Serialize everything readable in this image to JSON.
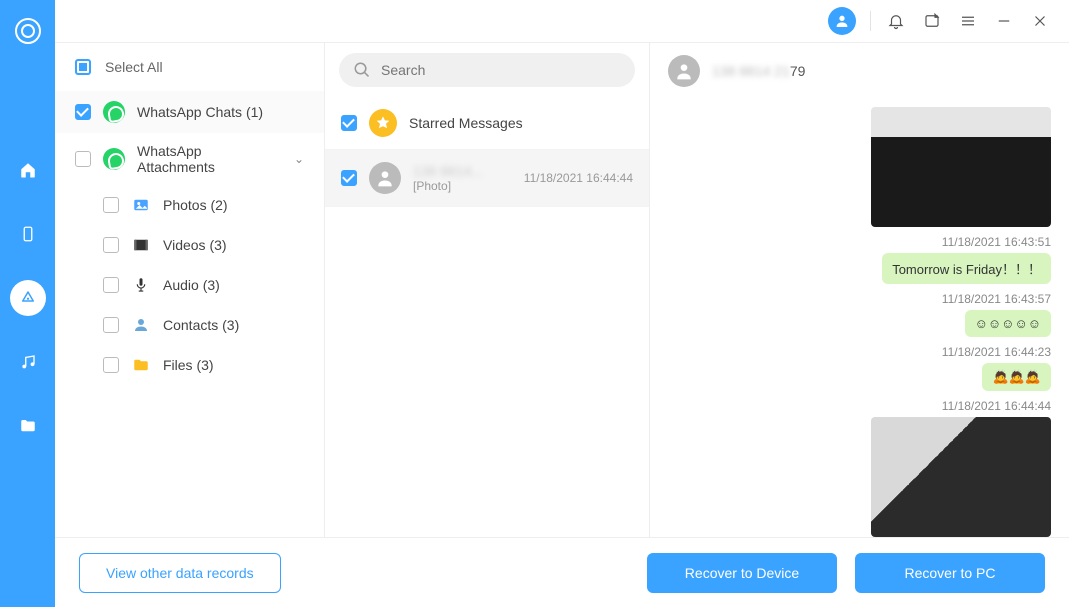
{
  "tree": {
    "select_all": "Select All",
    "items": [
      {
        "label": "WhatsApp Chats (1)",
        "icon": "whatsapp",
        "checked": true,
        "active": true,
        "level": 1
      },
      {
        "label": "WhatsApp Attachments",
        "icon": "whatsapp",
        "checked": false,
        "level": 1,
        "expandable": true
      },
      {
        "label": "Photos (2)",
        "icon": "photo",
        "checked": false,
        "level": 2
      },
      {
        "label": "Videos (3)",
        "icon": "video",
        "checked": false,
        "level": 2
      },
      {
        "label": "Audio (3)",
        "icon": "audio",
        "checked": false,
        "level": 2
      },
      {
        "label": "Contacts (3)",
        "icon": "contact",
        "checked": false,
        "level": 2
      },
      {
        "label": "Files (3)",
        "icon": "file",
        "checked": false,
        "level": 2
      }
    ]
  },
  "search": {
    "placeholder": "Search"
  },
  "conversations": {
    "starred_label": "Starred Messages",
    "items": [
      {
        "name_masked": "138 8814...",
        "preview": "[Photo]",
        "time": "11/18/2021 16:44:44",
        "checked": true
      }
    ]
  },
  "chat": {
    "contact_suffix": "79",
    "messages": [
      {
        "type": "image",
        "ts": "",
        "variant": "kb"
      },
      {
        "type": "text",
        "ts": "11/18/2021 16:43:51",
        "text": "Tomorrow is Friday！！！"
      },
      {
        "type": "text",
        "ts": "11/18/2021 16:43:57",
        "text": "☺☺☺☺☺"
      },
      {
        "type": "text",
        "ts": "11/18/2021 16:44:23",
        "text": "🙇🙇🙇"
      },
      {
        "type": "image",
        "ts": "11/18/2021 16:44:44",
        "variant": "phone"
      }
    ]
  },
  "footer": {
    "view_other": "View other data records",
    "recover_device": "Recover to Device",
    "recover_pc": "Recover to PC"
  }
}
